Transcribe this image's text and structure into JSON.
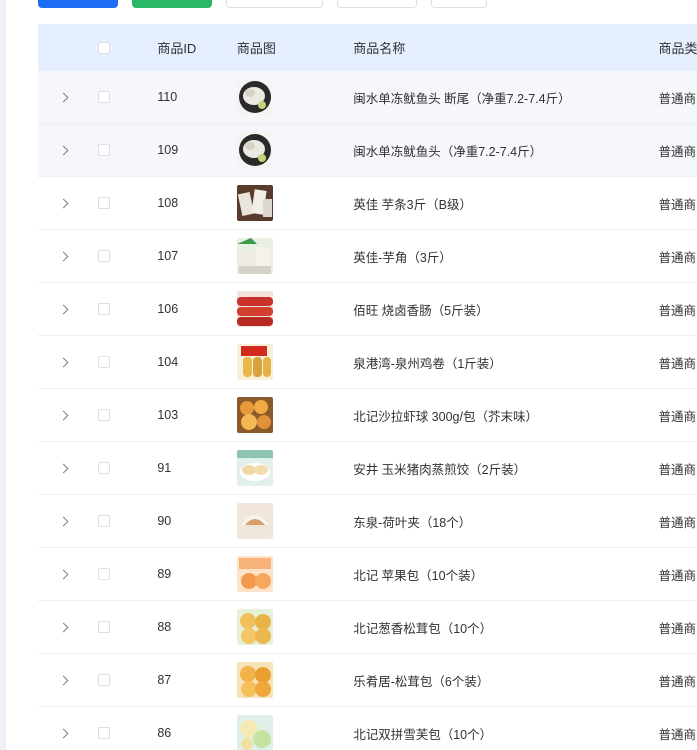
{
  "table": {
    "headers": {
      "id": "商品ID",
      "image": "商品图",
      "name": "商品名称",
      "type": "商品类"
    },
    "rows": [
      {
        "id": "110",
        "name": "闽水单冻鱿鱼头 断尾（净重7.2-7.4斤）",
        "type": "普通商",
        "image_icon": "squid-head-product-image"
      },
      {
        "id": "109",
        "name": "闽水单冻鱿鱼头（净重7.2-7.4斤）",
        "type": "普通商",
        "image_icon": "squid-head-product-image"
      },
      {
        "id": "108",
        "name": "英佳 芋条3斤（B级）",
        "type": "普通商",
        "image_icon": "taro-strips-product-image"
      },
      {
        "id": "107",
        "name": "英佳-芋角（3斤）",
        "type": "普通商",
        "image_icon": "taro-corner-product-image"
      },
      {
        "id": "106",
        "name": "佰旺 烧卤香肠（5斤装）",
        "type": "普通商",
        "image_icon": "sausage-product-image"
      },
      {
        "id": "104",
        "name": "泉港湾-泉州鸡卷（1斤装）",
        "type": "普通商",
        "image_icon": "chicken-roll-product-image"
      },
      {
        "id": "103",
        "name": "北记沙拉虾球 300g/包（芥末味）",
        "type": "普通商",
        "image_icon": "shrimp-ball-product-image"
      },
      {
        "id": "91",
        "name": "安井 玉米猪肉蒸煎饺（2斤装）",
        "type": "普通商",
        "image_icon": "dumpling-product-image"
      },
      {
        "id": "90",
        "name": "东泉-荷叶夹（18个）",
        "type": "普通商",
        "image_icon": "lotus-bun-product-image"
      },
      {
        "id": "89",
        "name": "北记 苹果包（10个装）",
        "type": "普通商",
        "image_icon": "apple-bun-product-image"
      },
      {
        "id": "88",
        "name": "北记葱香松茸包（10个）",
        "type": "普通商",
        "image_icon": "matsutake-bun-product-image"
      },
      {
        "id": "87",
        "name": "乐肴居-松茸包（6个装）",
        "type": "普通商",
        "image_icon": "matsutake-bun-product-image"
      },
      {
        "id": "86",
        "name": "北记双拼雪芙包（10个）",
        "type": "普通商",
        "image_icon": "snow-puff-bun-product-image"
      }
    ]
  },
  "colors": {
    "header_bg": "#e6efff",
    "row_hover_bg": "#f5f7fa",
    "primary": "#1d6cf2",
    "success": "#29b865",
    "border": "#ebeef5"
  }
}
